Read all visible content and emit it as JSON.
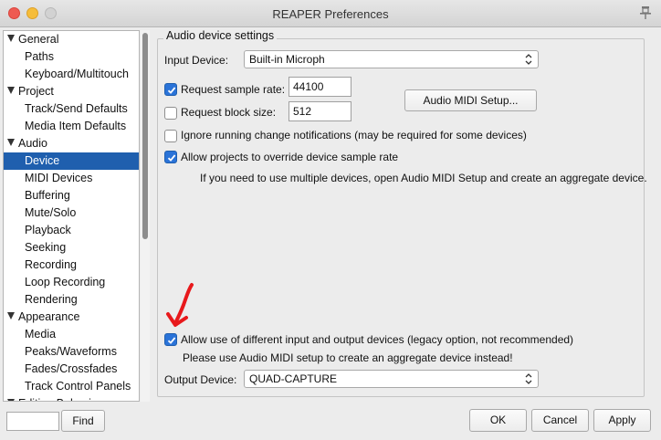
{
  "window": {
    "title": "REAPER Preferences"
  },
  "sidebar": {
    "items": [
      {
        "label": "General",
        "type": "group"
      },
      {
        "label": "Paths",
        "type": "child"
      },
      {
        "label": "Keyboard/Multitouch",
        "type": "child"
      },
      {
        "label": "Project",
        "type": "group"
      },
      {
        "label": "Track/Send Defaults",
        "type": "child"
      },
      {
        "label": "Media Item Defaults",
        "type": "child"
      },
      {
        "label": "Audio",
        "type": "group"
      },
      {
        "label": "Device",
        "type": "child",
        "selected": true
      },
      {
        "label": "MIDI Devices",
        "type": "child"
      },
      {
        "label": "Buffering",
        "type": "child"
      },
      {
        "label": "Mute/Solo",
        "type": "child"
      },
      {
        "label": "Playback",
        "type": "child"
      },
      {
        "label": "Seeking",
        "type": "child"
      },
      {
        "label": "Recording",
        "type": "child"
      },
      {
        "label": "Loop Recording",
        "type": "child"
      },
      {
        "label": "Rendering",
        "type": "child"
      },
      {
        "label": "Appearance",
        "type": "group"
      },
      {
        "label": "Media",
        "type": "child"
      },
      {
        "label": "Peaks/Waveforms",
        "type": "child"
      },
      {
        "label": "Fades/Crossfades",
        "type": "child"
      },
      {
        "label": "Track Control Panels",
        "type": "child"
      },
      {
        "label": "Editing Behavior",
        "type": "group"
      }
    ]
  },
  "find": {
    "value": "",
    "button_label": "Find"
  },
  "panel": {
    "group_title": "Audio device settings",
    "input_device": {
      "label": "Input Device:",
      "value": "Built-in Microph"
    },
    "request_sample_rate": {
      "label": "Request sample rate:",
      "checked": true,
      "value": "44100"
    },
    "request_block_size": {
      "label": "Request block size:",
      "checked": false,
      "value": "512"
    },
    "audio_midi_setup_button": "Audio MIDI Setup...",
    "ignore_notifications": {
      "label": "Ignore running change notifications (may be required for some devices)",
      "checked": false
    },
    "allow_override": {
      "label": "Allow projects to override device sample rate",
      "checked": true
    },
    "info_text": "If you need to use multiple devices, open Audio MIDI Setup and create an aggregate device.",
    "allow_different_devices": {
      "label": "Allow use of different input and output devices (legacy option, not recommended)",
      "checked": true
    },
    "aggregate_note": "Please use Audio MIDI setup to create an aggregate device instead!",
    "output_device": {
      "label": "Output Device:",
      "value": "QUAD-CAPTURE"
    }
  },
  "buttons": {
    "ok": "OK",
    "cancel": "Cancel",
    "apply": "Apply"
  },
  "colors": {
    "selection": "#1f5fae",
    "checkbox": "#2a73d8",
    "annotation_arrow": "#e8191c"
  },
  "icons": {
    "pin": "pin-icon",
    "tree_expand": "triangle-down-icon",
    "select_arrows": "updown-chevrons-icon",
    "annotation": "red-arrow-annotation"
  }
}
